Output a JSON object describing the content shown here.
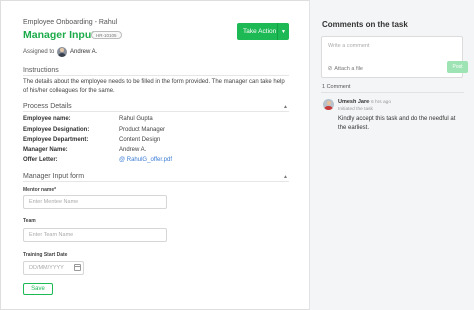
{
  "task": {
    "breadcrumb": "Employee Onboarding - Rahul",
    "title": "Manager Input",
    "tag": "HR-10105",
    "take_action_label": "Take Action",
    "assigned_label": "Assigned to",
    "assignee": "Andrew A."
  },
  "instructions": {
    "heading": "Instructions",
    "text": "The details about the employee needs to be filled in the form provided. The manager can take help of his/her colleagues for the same."
  },
  "process_details": {
    "heading": "Process Details",
    "rows": [
      {
        "label": "Employee name:",
        "value": "Rahul Gupta"
      },
      {
        "label": "Employee Designation:",
        "value": "Product Manager"
      },
      {
        "label": "Employee Department:",
        "value": "Content Design"
      },
      {
        "label": "Manager Name:",
        "value": "Andrew A."
      },
      {
        "label": "Offer Letter:",
        "value": "@ RahulG_offer.pdf"
      }
    ]
  },
  "form": {
    "heading": "Manager Input form",
    "mentor_label": "Mentor name*",
    "mentor_placeholder": "Enter Mentee Name",
    "team_label": "Team",
    "team_placeholder": "Enter Team Name",
    "date_label": "Training Start Date",
    "date_placeholder": "DD/MM/YYYY",
    "save_label": "Save"
  },
  "comments": {
    "title": "Comments on the task",
    "placeholder": "Write a comment",
    "attach_label": "Attach a file",
    "post_label": "Post",
    "count_label": "1 Comment",
    "items": [
      {
        "author": "Umesh Jare",
        "time": "• 6 hrs ago",
        "subtitle": "Initiated the task",
        "text": "Kindly accept this task and do the needful at the earliest."
      }
    ]
  },
  "icons": {
    "take_action_caret": "chevron-down-icon",
    "section_toggle": "chevron-up-icon",
    "attach": "paperclip-icon",
    "calendar": "calendar-icon"
  },
  "colors": {
    "accent": "#1db954",
    "title_green": "#1aab48",
    "link_blue": "#3a7bd5",
    "post_disabled": "#9ee3b4"
  }
}
